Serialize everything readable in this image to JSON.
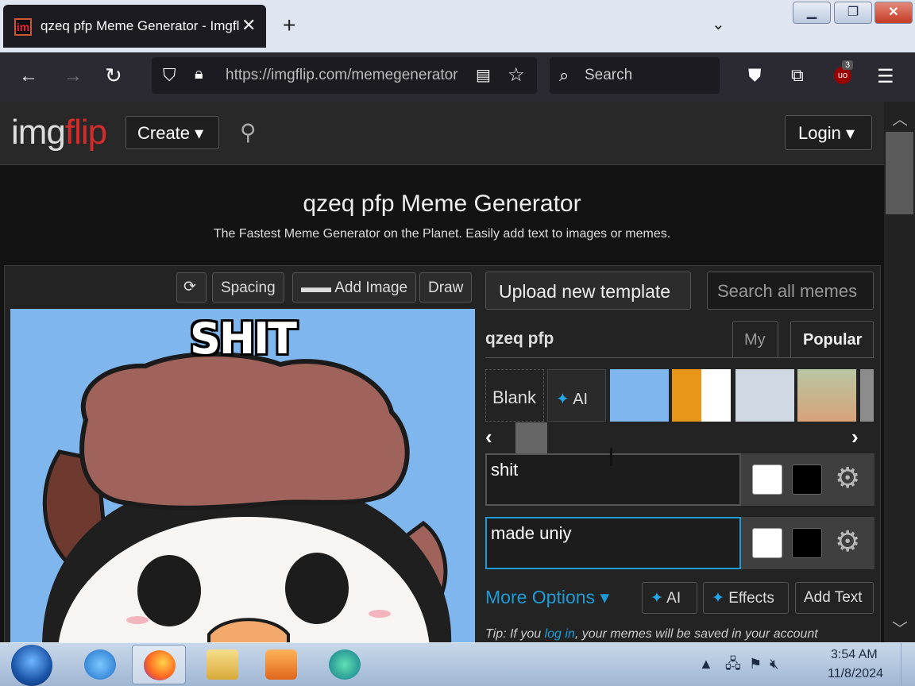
{
  "browser": {
    "tab_title": "qzeq pfp Meme Generator - Imgflip",
    "tab_close": "✕",
    "new_tab": "+",
    "url": "https://imgflip.com/memegenerator",
    "search_placeholder": "Search",
    "ublock_count": "3"
  },
  "site": {
    "logo_img": "img",
    "logo_flip": "flip",
    "create_label": "Create ▾",
    "login_label": "Login ▾"
  },
  "page": {
    "title": "qzeq pfp Meme Generator",
    "subtitle": "The Fastest Meme Generator on the Planet. Easily add text to images or memes."
  },
  "toolbar": {
    "rotate": "⟳",
    "spacing": "Spacing",
    "add_image": "Add Image",
    "draw": "Draw"
  },
  "meme": {
    "top_caption": "SHIT"
  },
  "sidebar": {
    "upload_label": "Upload new template",
    "search_placeholder": "Search all memes",
    "template_name": "qzeq pfp",
    "tab_my": "My",
    "tab_popular": "Popular",
    "blank_label": "Blank",
    "ai_label": "AI"
  },
  "text_boxes": [
    {
      "value": "shit"
    },
    {
      "value": "made uniy"
    }
  ],
  "actions": {
    "more_options": "More Options ▾",
    "ai": "AI",
    "effects": "Effects",
    "add_text": "Add Text"
  },
  "tip": {
    "prefix": "Tip: If you",
    "link": "log in",
    "suffix": ", your memes will be saved in your account"
  },
  "taskbar": {
    "time": "3:54 AM",
    "date": "11/8/2024"
  },
  "colors": {
    "accent": "#1e9bd6",
    "brand_red": "#d32c2c",
    "text_color_white": "#ffffff",
    "outline_color_black": "#000000"
  }
}
